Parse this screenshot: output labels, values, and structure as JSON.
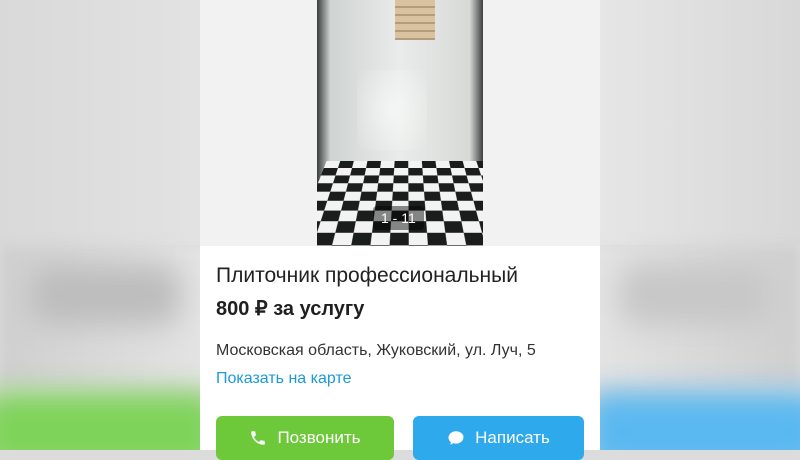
{
  "gallery": {
    "counter": "1 - 11"
  },
  "listing": {
    "title": "Плиточник профессиональный",
    "price": "800 ₽ за услугу",
    "address": "Московская область, Жуковский, ул. Луч, 5",
    "map_link": "Показать на карте"
  },
  "actions": {
    "call_label": "Позвонить",
    "write_label": "Написать"
  },
  "colors": {
    "call_button": "#6dc93a",
    "write_button": "#2ea9ec",
    "link": "#1a9ad6"
  },
  "icons": {
    "call": "phone-icon",
    "write": "chat-bubble-icon"
  }
}
